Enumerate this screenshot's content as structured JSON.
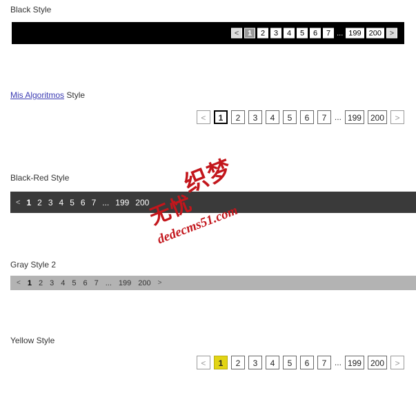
{
  "sections": [
    {
      "title": "Black Style",
      "title_link": null
    },
    {
      "title": "Style",
      "title_link": "Mis Algoritmos"
    },
    {
      "title": "Black-Red Style",
      "title_link": null
    },
    {
      "title": "Gray Style 2",
      "title_link": null
    },
    {
      "title": "Yellow Style",
      "title_link": null
    }
  ],
  "pagers": {
    "black": {
      "prev": "<",
      "next": ">",
      "dots": "...",
      "pages": [
        "1",
        "2",
        "3",
        "4",
        "5",
        "6",
        "7"
      ],
      "tail_pages": [
        "199",
        "200"
      ],
      "current": "1"
    },
    "mis": {
      "prev": "<",
      "next": ">",
      "dots": "...",
      "pages": [
        "1",
        "2",
        "3",
        "4",
        "5",
        "6",
        "7"
      ],
      "tail_pages": [
        "199",
        "200"
      ],
      "current": "1"
    },
    "blackred": {
      "prev": "<",
      "next": "",
      "dots": "...",
      "pages": [
        "1",
        "2",
        "3",
        "4",
        "5",
        "6",
        "7"
      ],
      "tail_pages": [
        "199",
        "200"
      ],
      "current": "1"
    },
    "gray2": {
      "prev": "<",
      "next": ">",
      "dots": "...",
      "pages": [
        "1",
        "2",
        "3",
        "4",
        "5",
        "6",
        "7"
      ],
      "tail_pages": [
        "199",
        "200"
      ],
      "current": "1"
    },
    "yellow": {
      "prev": "<",
      "next": ">",
      "dots": "...",
      "pages": [
        "1",
        "2",
        "3",
        "4",
        "5",
        "6",
        "7"
      ],
      "tail_pages": [
        "199",
        "200"
      ],
      "current": "1"
    }
  },
  "watermark": {
    "line1": "织梦",
    "line2": "无忧",
    "url": "dedecms51.com"
  }
}
